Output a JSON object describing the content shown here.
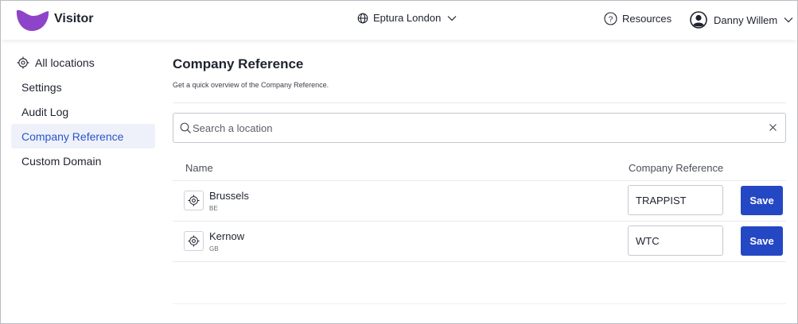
{
  "brand": {
    "app_name": "Visitor",
    "logo_color": "#8e44c9"
  },
  "header": {
    "location": "Eptura London",
    "resources_label": "Resources",
    "user_name": "Danny Willem"
  },
  "sidebar": {
    "items": [
      {
        "label": "All locations",
        "icon": "target-icon"
      },
      {
        "label": "Settings"
      },
      {
        "label": "Audit Log"
      },
      {
        "label": "Company Reference",
        "active": true
      },
      {
        "label": "Custom Domain"
      }
    ]
  },
  "main": {
    "title": "Company Reference",
    "subtitle": "Get a quick overview of the Company Reference.",
    "search": {
      "placeholder": "Search a location",
      "value": ""
    },
    "table": {
      "columns": [
        "Name",
        "Company Reference"
      ],
      "rows": [
        {
          "name": "Brussels",
          "code": "BE",
          "reference": "TRAPPIST",
          "save_label": "Save"
        },
        {
          "name": "Kernow",
          "code": "GB",
          "reference": "WTC",
          "save_label": "Save"
        }
      ]
    }
  },
  "colors": {
    "accent": "#2448c4",
    "active_bg": "#eef1f9",
    "active_text": "#2b55c9"
  }
}
